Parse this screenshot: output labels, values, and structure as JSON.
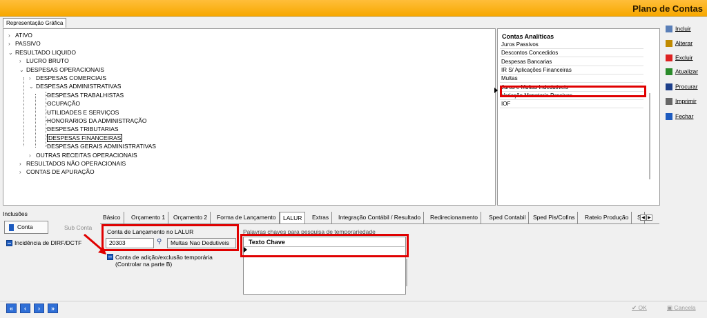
{
  "window": {
    "title": "Plano de Contas"
  },
  "tab": {
    "label": "Representação Gráfica"
  },
  "tree": [
    {
      "label": "ATIVO",
      "chevron": "›"
    },
    {
      "label": "PASSIVO",
      "chevron": "›"
    },
    {
      "label": "RESULTADO LIQUIDO",
      "chevron": "⌄"
    },
    {
      "label": "LUCRO BRUTO",
      "chevron": "›"
    },
    {
      "label": "DESPESAS OPERACIONAIS",
      "chevron": "⌄"
    },
    {
      "label": "DESPESAS COMERCIAIS",
      "chevron": "›"
    },
    {
      "label": "DESPESAS ADMINISTRATIVAS",
      "chevron": "⌄"
    },
    {
      "label": "DESPESAS TRABALHISTAS"
    },
    {
      "label": "OCUPAÇÃO"
    },
    {
      "label": "UTILIDADES E SERVIÇOS"
    },
    {
      "label": "HONORARIOS DA ADMINISTRAÇÃO"
    },
    {
      "label": "DESPESAS TRIBUTARIAS"
    },
    {
      "label": "DESPESAS FINANCEIRAS",
      "selected": true
    },
    {
      "label": "DESPESAS GERAIS ADMINISTRATIVAS"
    },
    {
      "label": "OUTRAS RECEITAS OPERACIONAIS",
      "chevron": "›"
    },
    {
      "label": "RESULTADOS NÃO OPERACIONAIS",
      "chevron": "›"
    },
    {
      "label": "CONTAS DE APURAÇÃO",
      "chevron": "›"
    }
  ],
  "accounts": {
    "header": "Contas Analíticas",
    "items": [
      "Juros Passivos",
      "Descontos Concedidos",
      "Despesas Bancarias",
      "IR S/ Aplicações Financeiras",
      "Multas",
      "Juros e Multas Indedutiveis",
      "Variação Monetaria Passivas",
      "IOF"
    ]
  },
  "side_buttons": [
    {
      "label": "Incluir",
      "icon": "include-icon"
    },
    {
      "label": "Alterar",
      "icon": "edit-icon"
    },
    {
      "label": "Excluir",
      "icon": "delete-icon"
    },
    {
      "label": "Atualizar",
      "icon": "refresh-icon"
    },
    {
      "label": "Procurar",
      "icon": "binoculars-icon"
    },
    {
      "label": "Imprimir",
      "icon": "printer-icon"
    },
    {
      "label": "Fechar",
      "icon": "close-window-icon"
    }
  ],
  "inclusoes": {
    "title": "Inclusões",
    "conta": "Conta",
    "sub_conta": "Sub Conta",
    "incidencia": "Incidência de DIRF/DCTF"
  },
  "detail_tabs": [
    "Básico",
    "Orçamento 1",
    "Orçamento 2",
    "Forma de Lançamento",
    "LALUR",
    "Extras",
    "Integração Contábil / Resultado",
    "Redirecionamento",
    "Sped Contabil",
    "Sped Pis/Cofins",
    "Rateio Produção",
    "S"
  ],
  "lalur": {
    "label": "Conta de Lançamento no LALUR",
    "code": "20303",
    "description": "Multas Nao Dedutiveis",
    "temp_line1": "Conta de adição/exclusão temporária",
    "temp_line2": "(Controlar na parte B)"
  },
  "keywords": {
    "label": "Palavras chaves para pesquisa de temporariedade",
    "column": "Texto Chave"
  },
  "footer": {
    "nav": [
      "«",
      "‹",
      "›",
      "»"
    ],
    "ok": "OK",
    "cancel": "Cancela"
  },
  "colors": {
    "accent": "#f7a800",
    "highlight": "#e00000",
    "button_blue": "#2f6fd6"
  }
}
